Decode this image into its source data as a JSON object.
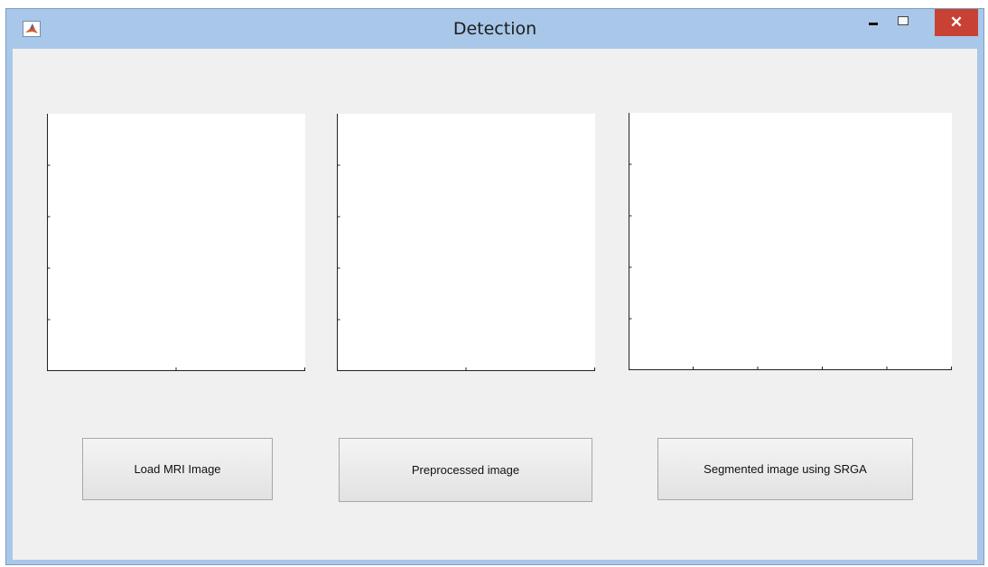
{
  "window": {
    "title": "Detection",
    "close_glyph": "✕",
    "app_icon": "matlab-icon"
  },
  "buttons": {
    "load": "Load MRI Image",
    "preprocess": "Preprocessed image",
    "segment": "Segmented image using SRGA"
  },
  "colors": {
    "titlebar": "#a9c7e8",
    "close_button": "#c84135",
    "client_background": "#f0f0f0",
    "axes_background": "#ffffff"
  }
}
